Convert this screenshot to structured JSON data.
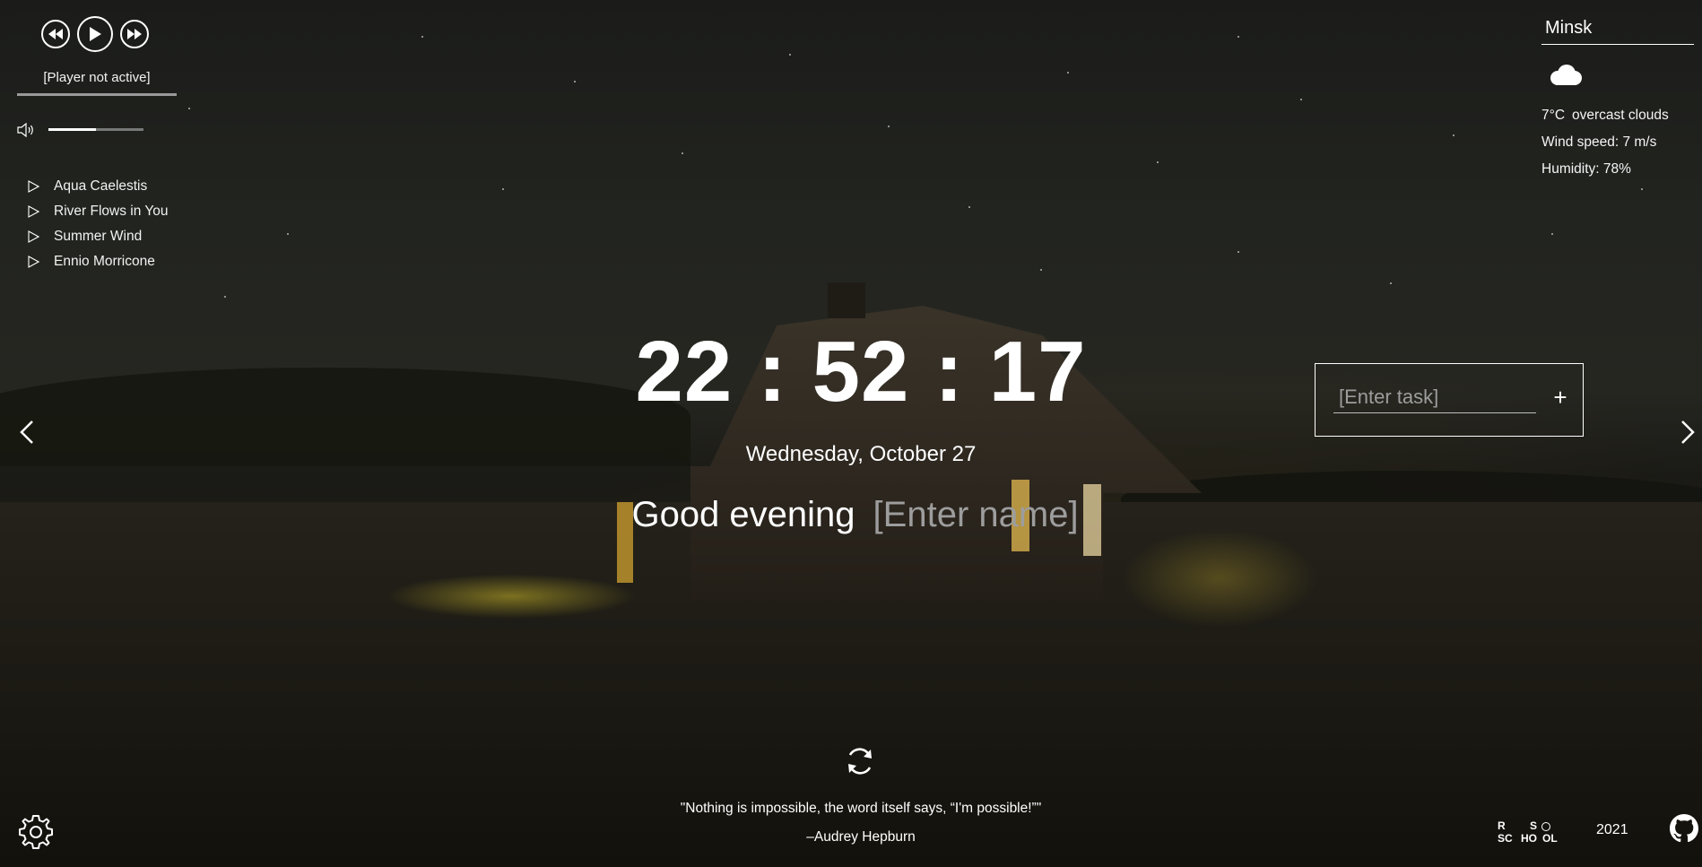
{
  "player": {
    "status": "[Player not active]",
    "progress_fraction": 0,
    "volume_fraction": 0.5,
    "controls": {
      "prev_icon": "rewind-icon",
      "play_icon": "play-icon",
      "next_icon": "fast-forward-icon"
    },
    "playlist": [
      {
        "title": "Aqua Caelestis"
      },
      {
        "title": "River Flows in You"
      },
      {
        "title": "Summer Wind"
      },
      {
        "title": "Ennio Morricone"
      }
    ]
  },
  "weather": {
    "city": "Minsk",
    "icon": "cloud-icon",
    "temperature": "7°C",
    "description": "overcast clouds",
    "wind": "Wind speed: 7 m/s",
    "humidity": "Humidity: 78%"
  },
  "clock": {
    "time": "22 : 52 : 17",
    "date": "Wednesday, October 27"
  },
  "greeting": {
    "text": "Good evening",
    "name_placeholder": "[Enter name]"
  },
  "todo": {
    "placeholder": "[Enter task]",
    "add_label": "+"
  },
  "quote": {
    "text": "\"Nothing is impossible, the word itself says, “I'm possible!”\"",
    "author": "–Audrey Hepburn"
  },
  "footer": {
    "year": "2021",
    "logo_lines": [
      "R S",
      "SC HO OL"
    ]
  },
  "colors": {
    "text": "#ffffff",
    "placeholder": "#9d9d9d"
  }
}
